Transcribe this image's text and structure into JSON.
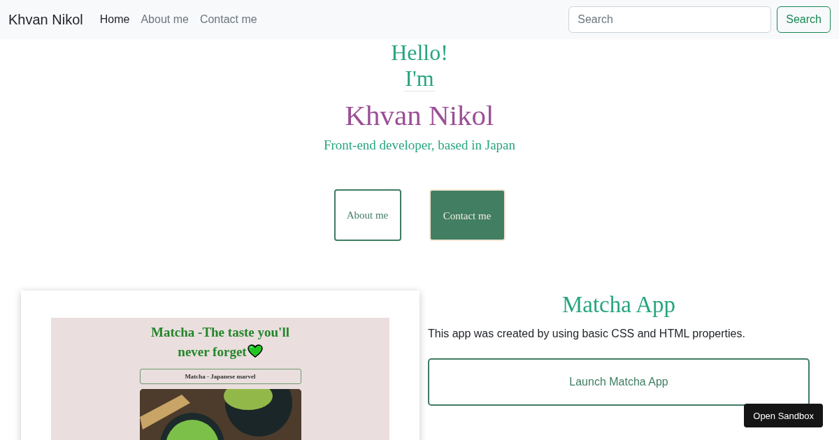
{
  "navbar": {
    "brand": "Khvan Nikol",
    "links": [
      {
        "label": "Home",
        "selected": true
      },
      {
        "label": "About me",
        "selected": false
      },
      {
        "label": "Contact me",
        "selected": false
      }
    ],
    "search": {
      "placeholder": "Search",
      "button": "Search"
    }
  },
  "hero": {
    "greeting": "Hello!",
    "intro": "I'm",
    "name": "Khvan Nikol",
    "tagline": "Front-end developer, based in Japan",
    "buttons": [
      {
        "label": "About me",
        "kind": "outline"
      },
      {
        "label": "Contact me",
        "kind": "filled"
      }
    ]
  },
  "project": {
    "preview": {
      "heading": "Matcha -The taste you'll never forget",
      "banner": "Matcha - Japanese marvel"
    },
    "title": "Matcha App",
    "description": "This app was created by using basic CSS and HTML properties.",
    "button": "Launch Matcha App"
  },
  "sandbox_button": "Open Sandbox"
}
